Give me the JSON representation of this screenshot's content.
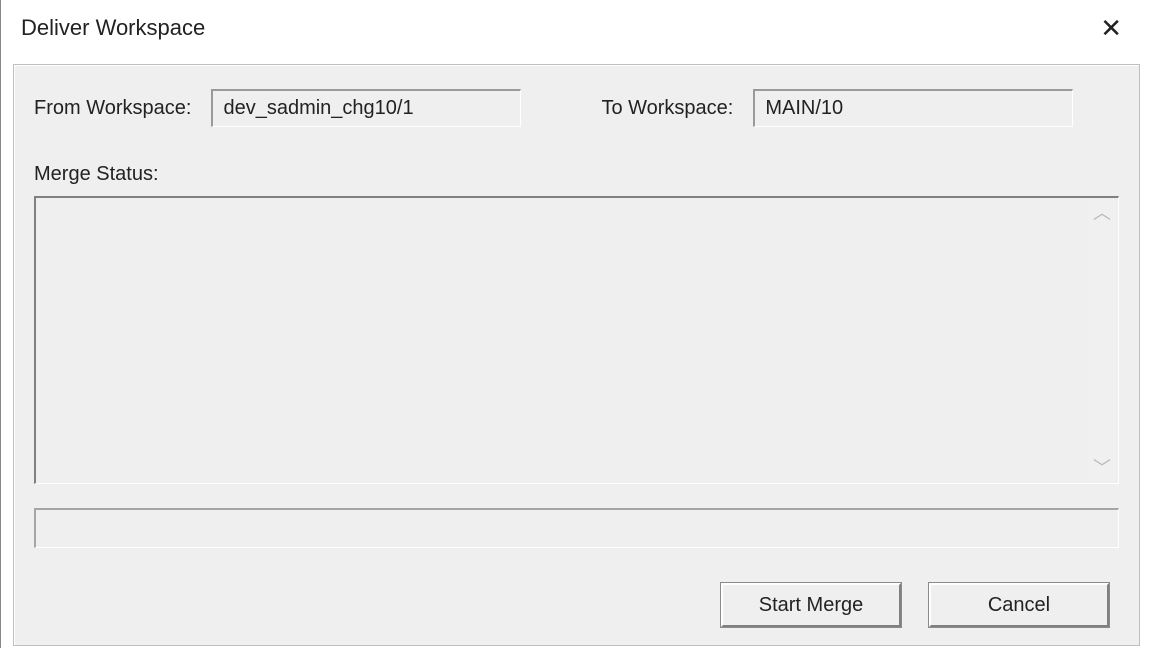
{
  "dialog": {
    "title": "Deliver Workspace"
  },
  "form": {
    "from_label": "From Workspace:",
    "from_value": "dev_sadmin_chg10/1",
    "to_label": "To Workspace:",
    "to_value": "MAIN/10",
    "merge_status_label": "Merge Status:",
    "merge_status_value": ""
  },
  "buttons": {
    "start_merge": "Start Merge",
    "cancel": "Cancel"
  }
}
